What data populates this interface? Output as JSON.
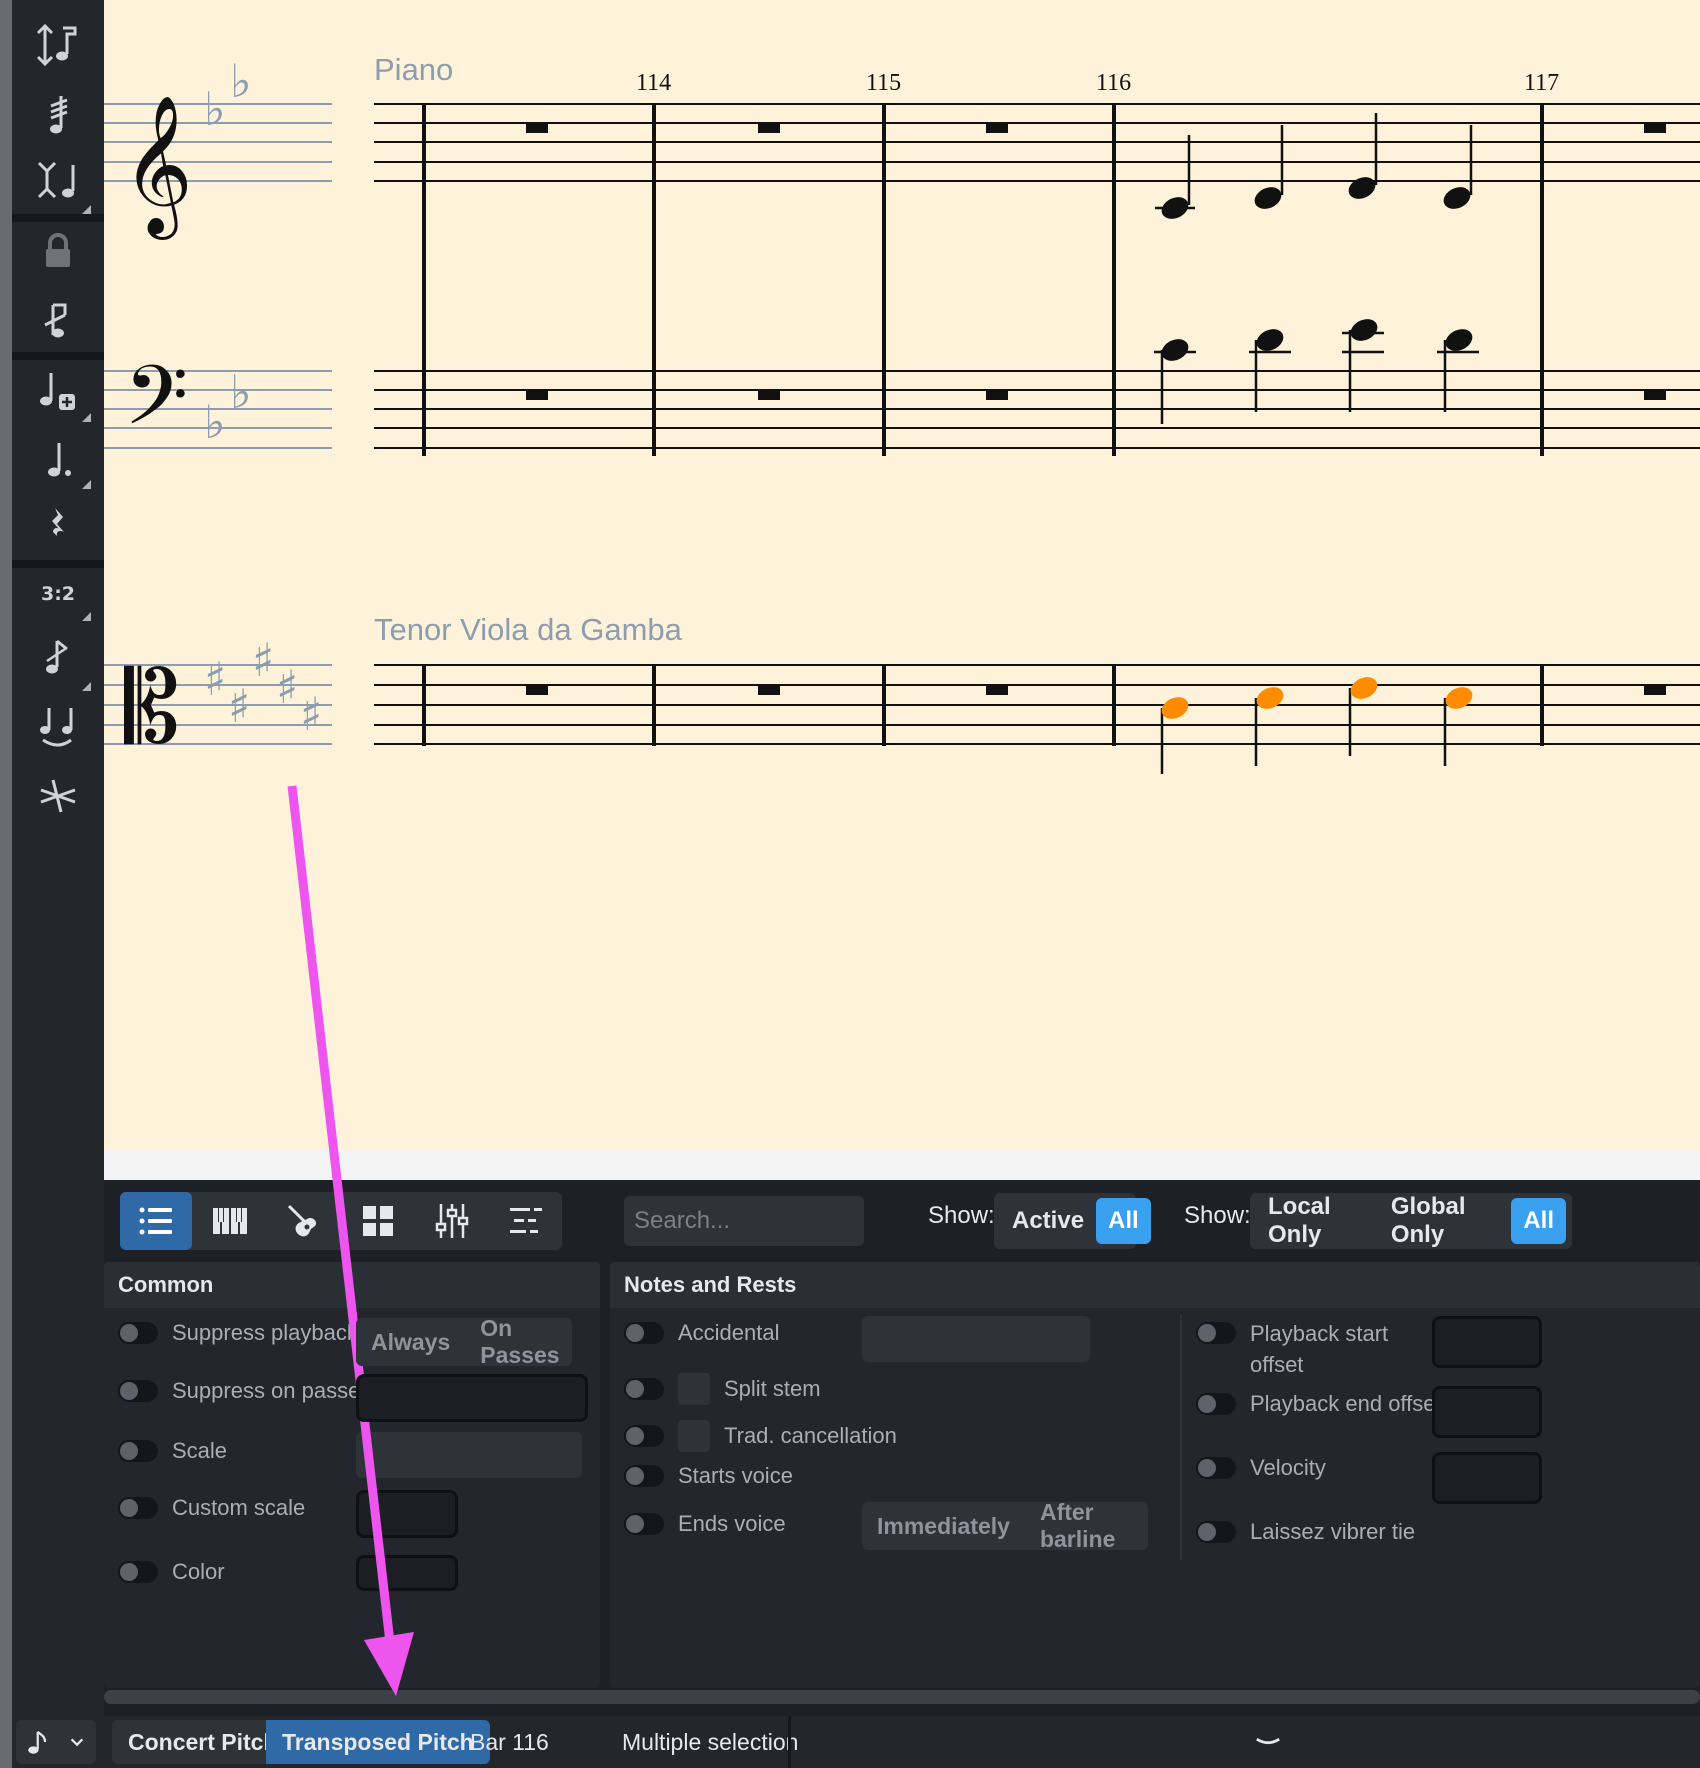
{
  "score": {
    "instruments": [
      "Piano",
      "Tenor Viola da Gamba"
    ],
    "bar_numbers": [
      "114",
      "115",
      "116",
      "117"
    ],
    "selection_color": "#ff8c00",
    "staff_color": "#8c9db0"
  },
  "toolbox": {
    "tools": [
      "note-input-icon",
      "tremolo-icon",
      "stem-direction-icon",
      "lock-icon",
      "grace-note-icon",
      "add-note-icon",
      "dotted-note-icon",
      "rest-icon",
      "tuplet-icon",
      "acciaccatura-icon",
      "tie-icon",
      "scissors-icon"
    ],
    "tuplet_label": "3:2"
  },
  "properties": {
    "search_placeholder": "Search...",
    "show_label_1": "Show:",
    "show_options_1": [
      "Active",
      "All"
    ],
    "show_selected_1": "All",
    "show_label_2": "Show:",
    "show_options_2": [
      "Local Only",
      "Global Only",
      "All"
    ],
    "show_selected_2": "All",
    "accent_color": "#3aa0f0",
    "common": {
      "title": "Common",
      "rows": [
        "Suppress playback",
        "Suppress on passes",
        "Scale",
        "Custom scale",
        "Color"
      ],
      "suppress_options": [
        "Always",
        "On Passes"
      ]
    },
    "notes_rests": {
      "title": "Notes and Rests",
      "rows": [
        "Accidental",
        "Split stem",
        "Trad. cancellation",
        "Starts voice",
        "Ends voice"
      ],
      "ends_voice_options": [
        "Immediately",
        "After barline"
      ],
      "right_rows": [
        "Playback start offset",
        "Playback end offset",
        "Velocity",
        "Laissez vibrer tie"
      ]
    }
  },
  "status": {
    "concert_pitch": "Concert Pitch",
    "transposed_pitch": "Transposed Pitch",
    "bar": "Bar 116",
    "selection": "Multiple selection"
  }
}
